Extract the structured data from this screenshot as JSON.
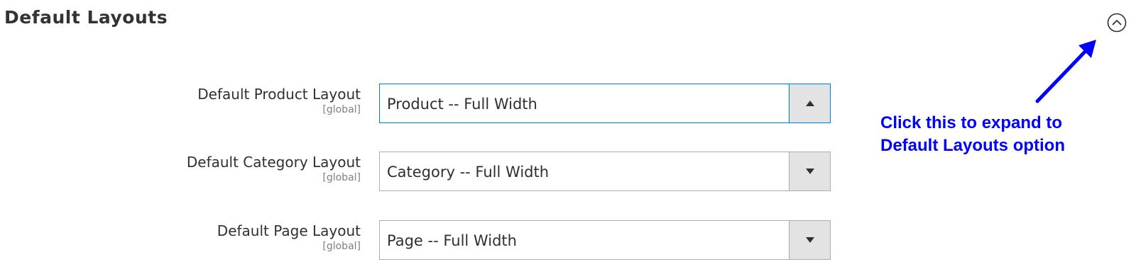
{
  "section": {
    "title": "Default Layouts",
    "toggle_icon": "chevron-up-circle-icon"
  },
  "fields": [
    {
      "label": "Default Product Layout",
      "scope": "[global]",
      "value": "Product -- Full Width",
      "state": "open",
      "arrow_icon": "caret-up-icon"
    },
    {
      "label": "Default Category Layout",
      "scope": "[global]",
      "value": "Category -- Full Width",
      "state": "closed",
      "arrow_icon": "caret-down-icon"
    },
    {
      "label": "Default Page Layout",
      "scope": "[global]",
      "value": "Page -- Full Width",
      "state": "closed",
      "arrow_icon": "caret-down-icon"
    }
  ],
  "annotation": {
    "line1": "Click this to expand to",
    "line2": "Default Layouts option",
    "color": "#0000ff"
  },
  "colors": {
    "focus_border": "#007bdb",
    "border": "#adadad",
    "arrow_bg": "#e3e3e3"
  }
}
